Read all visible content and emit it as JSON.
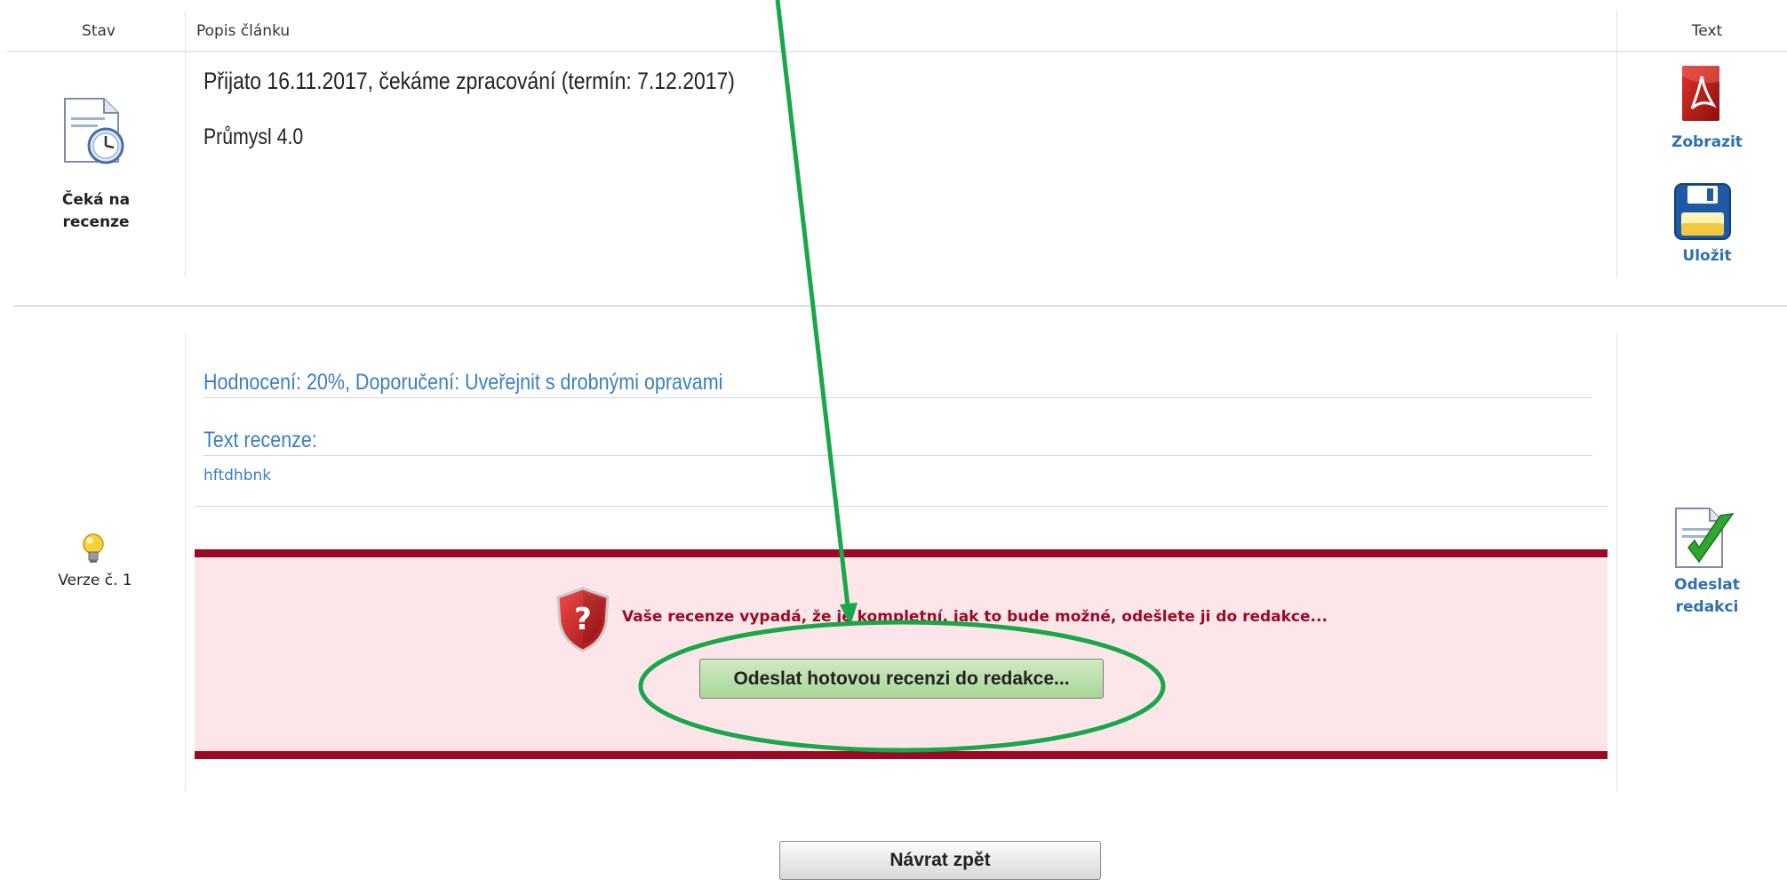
{
  "table": {
    "col_status": "Stav",
    "col_description": "Popis článku",
    "col_text": "Text"
  },
  "article": {
    "status_line": "Přijato 16.11.2017, čekáme zpracování (termín: 7.12.2017)",
    "title": "Průmysl 4.0",
    "status_label": "Čeká na recenze",
    "view_label": "Zobrazit",
    "save_label": "Uložit"
  },
  "review": {
    "version_label": "Verze č. 1",
    "rating_line": "Hodnocení: 20%, Doporučení: Uveřejnit s drobnými opravami",
    "text_heading": "Text recenze:",
    "text_body": "hftdhbnk",
    "send_label": "Odeslat redakci",
    "alert_message": "Vaše recenze vypadá, že je kompletní, jak to bude možné, odešlete ji do redakce...",
    "submit_button": "Odeslat hotovou recenzi do redakce..."
  },
  "footer": {
    "back_button": "Návrat zpět"
  },
  "colors": {
    "link": "#2f6fb0",
    "alert_border": "#9b0a24",
    "alert_bg": "#fce6ea",
    "annotation": "#1aa64a"
  }
}
